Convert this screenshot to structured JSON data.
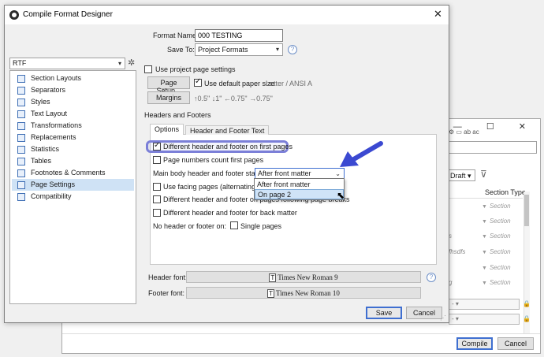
{
  "dialog": {
    "title": "Compile Format Designer",
    "close_glyph": "✕",
    "format_name_label": "Format Name:",
    "format_name_value": "000 TESTING",
    "save_to_label": "Save To:",
    "save_to_value": "Project Formats",
    "help_glyph": "?"
  },
  "left_panel": {
    "format_select": "RTF",
    "items": [
      {
        "label": "Section Layouts",
        "selected": false
      },
      {
        "label": "Separators",
        "selected": false
      },
      {
        "label": "Styles",
        "selected": false
      },
      {
        "label": "Text Layout",
        "selected": false
      },
      {
        "label": "Transformations",
        "selected": false
      },
      {
        "label": "Replacements",
        "selected": false
      },
      {
        "label": "Statistics",
        "selected": false
      },
      {
        "label": "Tables",
        "selected": false
      },
      {
        "label": "Footnotes & Comments",
        "selected": false
      },
      {
        "label": "Page Settings",
        "selected": true
      },
      {
        "label": "Compatibility",
        "selected": false
      }
    ]
  },
  "page_settings": {
    "use_project_label": "Use project page settings",
    "page_setup_button": "Page Setup...",
    "use_default_paper_label": "Use default paper size",
    "paper_size": "Letter / ANSI A",
    "margins_button": "Margins",
    "margins_value": "↑0.5\" ↓1\" ←0.75\" →0.75\"",
    "headers_footers_title": "Headers and Footers",
    "tabs": [
      "Options",
      "Header and Footer Text"
    ],
    "options": {
      "different_first": "Different header and footer on first pages",
      "page_numbers_count": "Page numbers count first pages",
      "main_body_label": "Main body header and footer starts:",
      "main_body_value": "After front matter",
      "dropdown_options": [
        "After front matter",
        "On page 2"
      ],
      "use_facing": "Use facing pages (alternating mar",
      "different_following": "Different header and footer on pages following page breaks",
      "different_back": "Different header and footer for back matter",
      "no_header_label": "No header or footer on:",
      "single_pages": "Single pages"
    },
    "header_font_label": "Header font:",
    "header_font_value": "Times New Roman 9",
    "footer_font_label": "Footer font:",
    "footer_font_value": "Times New Roman 10",
    "font_glyph": "T"
  },
  "buttons": {
    "save": "Save",
    "cancel": "Cancel"
  },
  "background_window": {
    "draft": "Draft",
    "section_type_header": "Section Type",
    "section_rows": [
      "Section",
      "Section",
      "Section",
      "Section",
      "Section",
      "Section"
    ],
    "frag_1": "fhsdfs",
    "frag_2": "g",
    "frag_3": "s",
    "compile_button": "Compile",
    "cancel_button": "Cancel"
  },
  "colors": {
    "accent_blue": "#3f6fd0",
    "highlight_purple": "#7b7fd8",
    "arrow_blue": "#3b49d1",
    "selection": "#cfe2f5"
  }
}
